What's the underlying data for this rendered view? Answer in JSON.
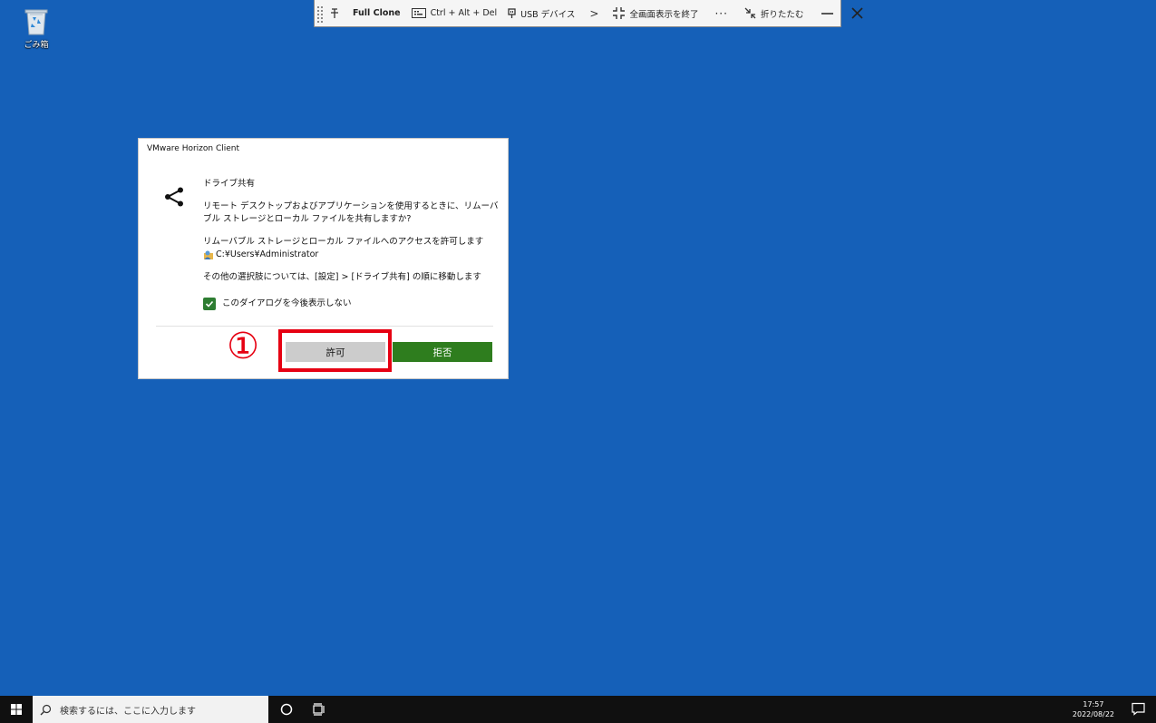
{
  "desktop": {
    "recycle_bin_label": "ごみ箱",
    "background_color": "#1560b8"
  },
  "toolbar": {
    "pin_icon": "pin-icon",
    "full_clone_label": "Full Clone",
    "ctrl_alt_del_label": "Ctrl + Alt + Del",
    "usb_label": "USB デバイス",
    "more_arrow": ">",
    "exit_fullscreen_label": "全画面表示を終了",
    "overflow_label": "···",
    "collapse_label": "折りたたむ"
  },
  "dialog": {
    "title": "VMware Horizon Client",
    "heading": "ドライブ共有",
    "question": "リモート デスクトップおよびアプリケーションを使用するときに、リムーバブル ストレージとローカル ファイルを共有しますか?",
    "allow_text": "リムーバブル ストレージとローカル ファイルへのアクセスを許可します",
    "path": "C:¥Users¥Administrator",
    "other_options": "その他の選択肢については、[設定] > [ドライブ共有] の順に移動します",
    "checkbox_label": "このダイアログを今後表示しない",
    "checkbox_checked": true,
    "allow_button": "許可",
    "deny_button": "拒否",
    "deny_color": "#2e7d1e"
  },
  "annotation": {
    "number": "①",
    "color": "#e60012"
  },
  "taskbar": {
    "search_placeholder": "検索するには、ここに入力します",
    "time": "17:57",
    "date": "2022/08/22"
  }
}
